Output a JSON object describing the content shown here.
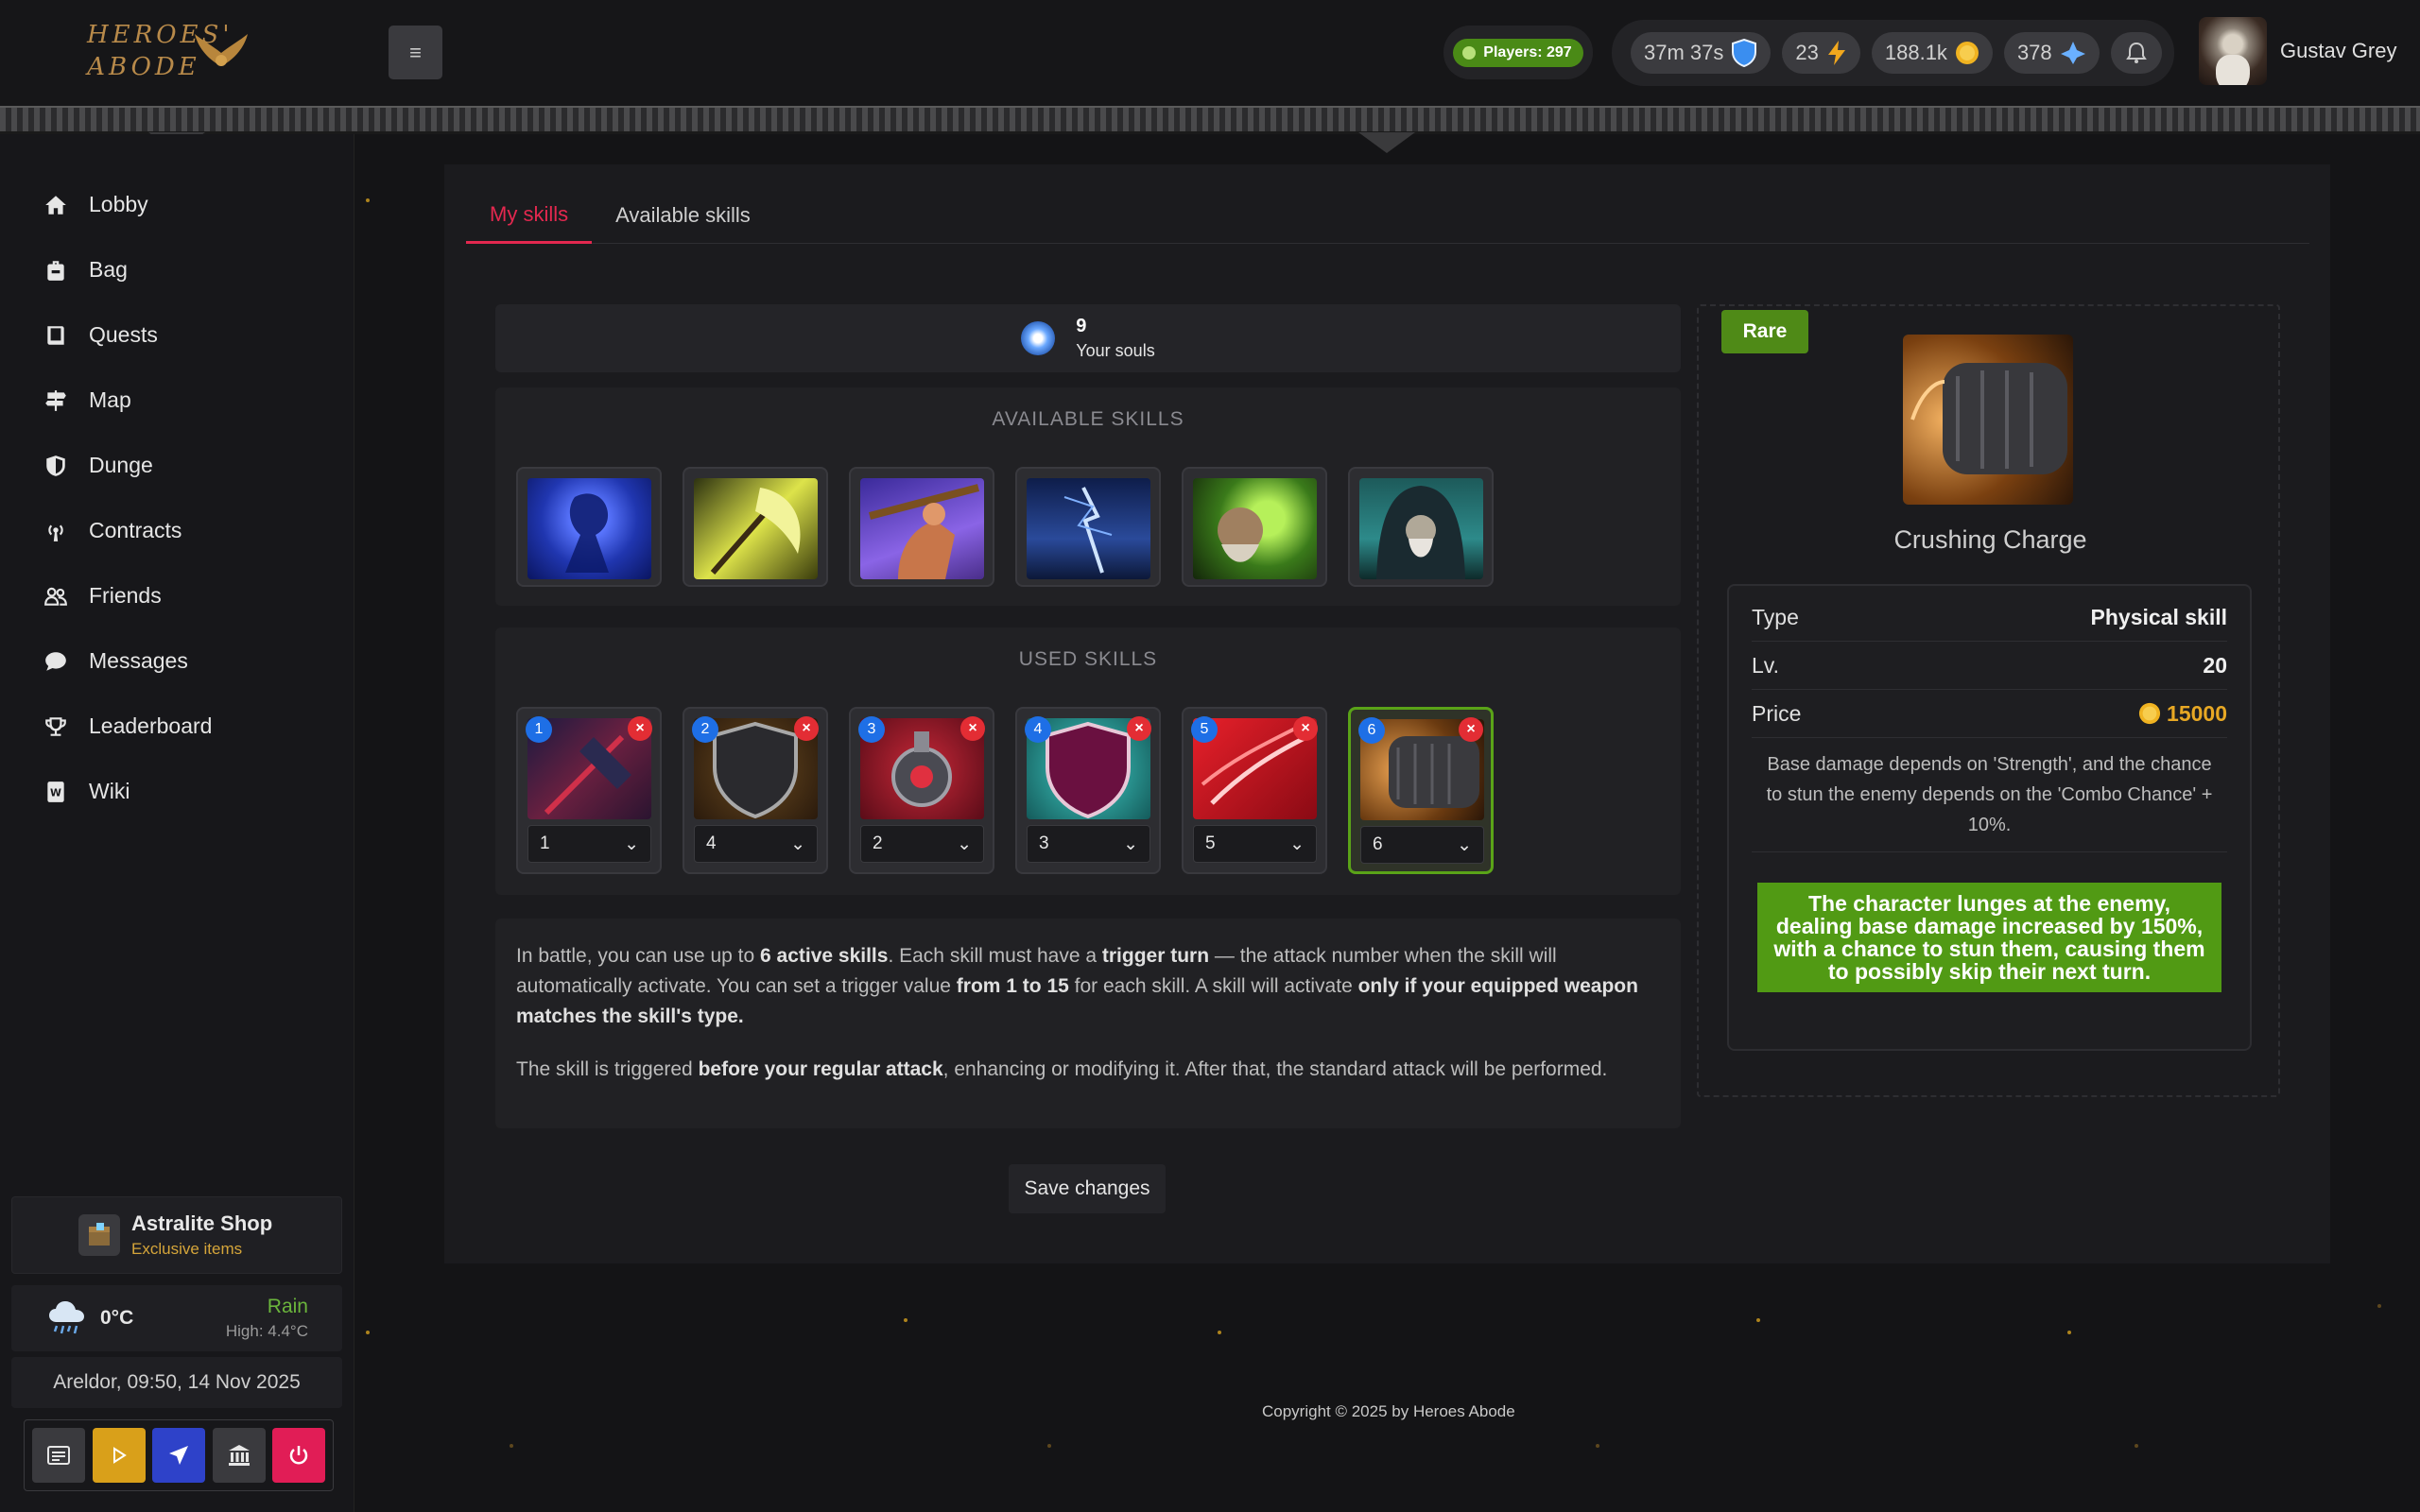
{
  "brand": {
    "logo_text": "HEROES' ABODE"
  },
  "header": {
    "players": "Players: 297",
    "timer": "37m 37s",
    "energy": "23",
    "gold": "188.1k",
    "souls": "378",
    "user_name": "Gustav Grey"
  },
  "sidebar": {
    "items": [
      {
        "label": "Lobby",
        "icon": "home-icon"
      },
      {
        "label": "Bag",
        "icon": "bag-icon"
      },
      {
        "label": "Quests",
        "icon": "book-icon"
      },
      {
        "label": "Map",
        "icon": "signpost-icon"
      },
      {
        "label": "Dunge",
        "icon": "shield-icon"
      },
      {
        "label": "Contracts",
        "icon": "broadcast-icon"
      },
      {
        "label": "Friends",
        "icon": "people-icon"
      },
      {
        "label": "Messages",
        "icon": "chat-icon"
      },
      {
        "label": "Leaderboard",
        "icon": "trophy-icon"
      },
      {
        "label": "Wiki",
        "icon": "wiki-icon"
      }
    ],
    "shop": {
      "title": "Astralite Shop",
      "subtitle": "Exclusive items"
    },
    "weather": {
      "temp": "0°C",
      "condition": "Rain",
      "high": "High: 4.4°C"
    },
    "datetime": "Areldor, 09:50, 14 Nov 2025"
  },
  "tabs": {
    "active": "My skills",
    "other": "Available skills"
  },
  "souls": {
    "count": "9",
    "label": "Your souls"
  },
  "available_skills": {
    "title": "AVAILABLE SKILLS"
  },
  "used_skills": {
    "title": "USED SKILLS",
    "slots": [
      {
        "num": "1",
        "turn": "1"
      },
      {
        "num": "2",
        "turn": "4"
      },
      {
        "num": "3",
        "turn": "2"
      },
      {
        "num": "4",
        "turn": "3"
      },
      {
        "num": "5",
        "turn": "5"
      },
      {
        "num": "6",
        "turn": "6"
      }
    ]
  },
  "info": {
    "p1_a": "In battle, you can use up to ",
    "p1_b": "6 active skills",
    "p1_c": ". Each skill must have a ",
    "p1_d": "trigger turn",
    "p1_e": " — the attack number when the skill will automatically activate. You can set a trigger value ",
    "p1_f": "from 1 to 15",
    "p1_g": " for each skill. A skill will activate ",
    "p1_h": "only if your equipped weapon matches the skill's type.",
    "p2_a": "The skill is triggered ",
    "p2_b": "before your regular attack",
    "p2_c": ", enhancing or modifying it. After that, the standard attack will be performed."
  },
  "save_label": "Save changes",
  "detail": {
    "rarity": "Rare",
    "name": "Crushing Charge",
    "type_label": "Type",
    "type_value": "Physical skill",
    "lv_label": "Lv.",
    "lv_value": "20",
    "price_label": "Price",
    "price_value": "15000",
    "description": "Base damage depends on 'Strength', and the chance to stun the enemy depends on the 'Combo Chance' + 10%.",
    "effect": "The character lunges at the enemy, dealing base damage increased by 150%, with a chance to stun them, causing them to possibly skip their next turn."
  },
  "footer": "Copyright © 2025 by Heroes Abode"
}
